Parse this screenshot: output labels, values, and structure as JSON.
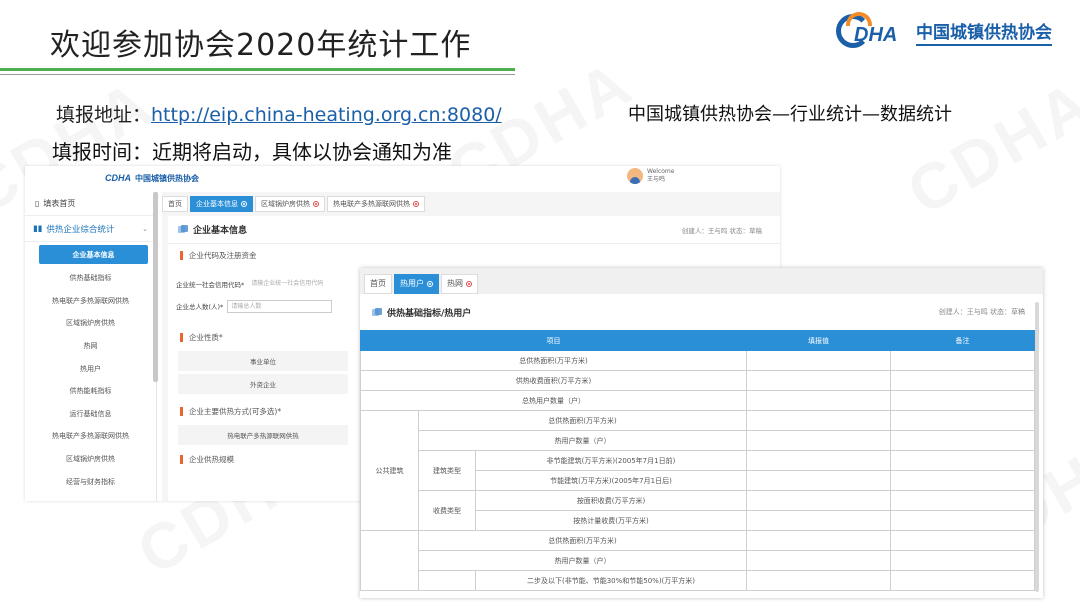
{
  "slide": {
    "title": "欢迎参加协会2020年统计工作",
    "org_name": "中国城镇供热协会",
    "logo_text": "DHA",
    "address_label": "填报地址：",
    "address_url": "http://eip.china-heating.org.cn:8080/",
    "time_label": "填报时间：",
    "time_text": "近期将启动，具体以协会通知为准",
    "right_caption": "中国城镇供热协会—行业统计—数据统计",
    "watermark": "CDHA"
  },
  "screen1": {
    "header_logo": "中国城镇供热协会",
    "welcome": "Welcome",
    "username": "王与鸣",
    "sidebar": {
      "home": "填表首页",
      "group": "供热企业综合统计",
      "items": [
        "企业基本信息",
        "供热基础指标",
        "热电联产多热源联网供热",
        "区域锅炉房供热",
        "热网",
        "热用户",
        "供热能耗指标",
        "运行基础信息",
        "热电联产多热源联网供热",
        "区域锅炉房供热",
        "经营与财务指标"
      ]
    },
    "tabs": [
      "首页",
      "企业基本信息",
      "区域锅炉房供热",
      "热电联产多热源联网供热"
    ],
    "panel_title": "企业基本信息",
    "meta": "创建人：王与鸣     状态：草稿",
    "section_code": "企业代码及注册资金",
    "field1_label": "企业统一社会信用代码*",
    "field1_placeholder": "请输企业统一社会信用代码",
    "field2_label": "企业总人数(人)*",
    "field2_placeholder": "请输总人数",
    "section_nature": "企业性质*",
    "nature_options": [
      "事业单位",
      "外资企业"
    ],
    "section_mode": "企业主要供热方式(可多选)*",
    "mode_option": "热电联产多热源联网供热",
    "section_cut": "企业供热规模"
  },
  "screen2": {
    "tabs": [
      "首页",
      "热用户",
      "热网"
    ],
    "panel_title": "供热基础指标/热用户",
    "meta": "创建人：王与鸣     状态：草稿",
    "columns": [
      "项目",
      "填报值",
      "备注"
    ],
    "rows_top": [
      "总供热面积(万平方米)",
      "供热收费面积(万平方米)",
      "总热用户数量（户）"
    ],
    "public_building": "公共建筑",
    "building_type": "建筑类型",
    "fee_type": "收费类型",
    "pb_rows": [
      "总供热面积(万平方米)",
      "热用户数量（户）"
    ],
    "bt_rows": [
      "非节能建筑(万平方米)(2005年7月1日前)",
      "节能建筑(万平方米)(2005年7月1日后)"
    ],
    "ft_rows": [
      "按面积收费(万平方米)",
      "按热计量收费(万平方米)"
    ],
    "rows_bottom": [
      "总供热面积(万平方米)",
      "热用户数量（户）",
      "二步及以下(非节能、节能30%和节能50%)(万平方米)"
    ]
  }
}
